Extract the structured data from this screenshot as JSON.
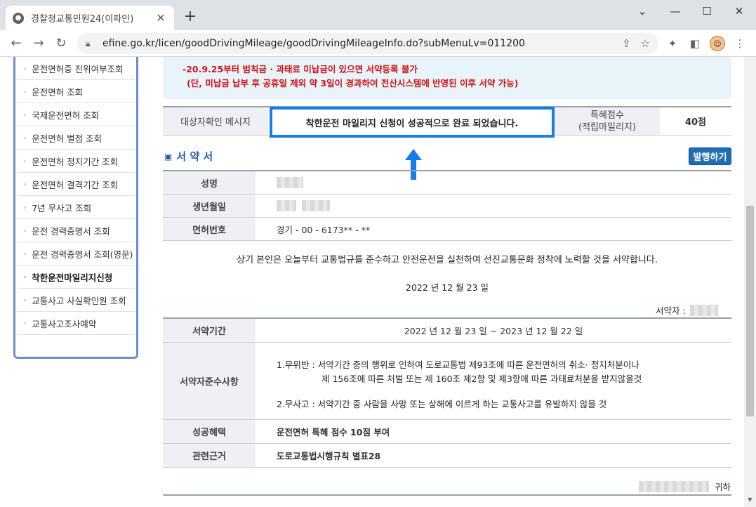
{
  "browser": {
    "tab_title": "경찰청교통민원24(이파인)",
    "tab_close": "✕",
    "new_tab": "+",
    "url": "efine.go.kr/licen/goodDrivingMileage/goodDrivingMileageInfo.do?subMenuLv=011200",
    "window_controls": [
      "⌄",
      "—",
      "☐",
      "✕"
    ]
  },
  "sidebar": {
    "items": [
      {
        "label": "운전면허증 진위여부조회"
      },
      {
        "label": "운전면허 조회"
      },
      {
        "label": "국제운전면허 조회"
      },
      {
        "label": "운전면허 벌점 조회"
      },
      {
        "label": "운전면허 정지기간 조회"
      },
      {
        "label": "운전면허 결격기간 조회"
      },
      {
        "label": "7년 무사고 조회"
      },
      {
        "label": "운전 경력증명서 조회"
      },
      {
        "label": "운전 경력증명서 조회(영문)"
      },
      {
        "label": "착한운전마일리지신청",
        "active": true
      },
      {
        "label": "교통사고 사실확인원 조회"
      },
      {
        "label": "교통사고조사예약"
      }
    ]
  },
  "notice": {
    "line1": "-20.9.25부터 범칙금 · 과태료 미납금이 있으면 서약등록 불가",
    "line2": "(단, 미납금 납부 후 공휴일 제외 약 3일이 경과하여 전산시스템에 반영된 이후 서약 가능)"
  },
  "confirm": {
    "label": "대상자확인 메시지",
    "message": "착한운전 마일리지 신청이 성공적으로 완료 되었습니다.",
    "points_label_1": "특혜점수",
    "points_label_2": "(적립마일리지)",
    "points_value": "40점"
  },
  "pledge_section": {
    "title": "서 약 서",
    "issue_button": "발행하기",
    "name_label": "성명",
    "birth_label": "생년월일",
    "license_label": "면허번호",
    "license_value": "경기 - 00 - 6173** - **",
    "pledge_text": "상기 본인은 오늘부터 교통법규를 준수하고 안전운전을 실천하여 선진교통문화 정착에 노력할 것을 서약합니다.",
    "pledge_date": "2022 년 12 월 23 일",
    "signer_label": "서약자 :",
    "period_label": "서약기간",
    "period_value": "2022 년 12 월 23 일 ~ 2023 년 12 월 22 일",
    "terms_label": "서약자준수사항",
    "term1_line1": "1.무위반 : 서약기간 중의 행위로 인하여 도로교통법 제93조에 따른 운전면허의 취소· 정지처분이나",
    "term1_line2": "제 156조에 따른 처벌 또는 제 160조 제2항 및 제3항에 따른 과태료처분을 받지않을것",
    "term2": "2.무사고 : 서약기간 중 사람을 사망 또는 상해에 이르게 하는 교통사고를 유발하지 않을 것",
    "benefit_label": "성공혜택",
    "benefit_value": "운전면허 특혜 점수 10점 부여",
    "basis_label": "관련근거",
    "basis_value": "도로교통법시행규칙 별표28",
    "addressee_suffix": "귀하"
  },
  "colors": {
    "highlight": "#1a7ce8",
    "notice_red": "#d0141b",
    "accent_blue": "#1f6db5"
  }
}
